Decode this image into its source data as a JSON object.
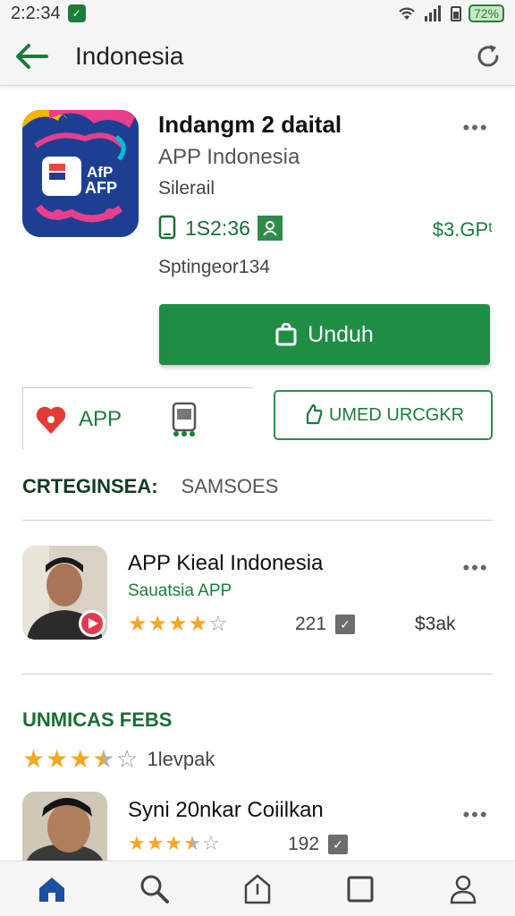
{
  "status_bar": {
    "time": "2:2:34",
    "battery": "72%"
  },
  "app_bar": {
    "title": "Indonesia"
  },
  "app": {
    "name": "Indangm 2 daital",
    "subtitle": "APP Indonesia",
    "category": "Silerail",
    "size": "1S2:36",
    "price": "$3.GPᵗ",
    "developer": "Sptingeor134",
    "icon_text_line1": "AfP",
    "icon_text_line2": "AFP",
    "install_label": "Unduh"
  },
  "actions": {
    "favorite_label": "APP",
    "wishlist_label": "UMED URCGKR"
  },
  "categories": {
    "heading": "CRTEGINSEA:",
    "value": "SAMSOES"
  },
  "list_items": [
    {
      "title": "APP Kieal Indonesia",
      "developer": "Sauatsia APP",
      "rating": 4,
      "count": "221",
      "price": "$3ak"
    },
    {
      "title": "Syni 20nkar Coiilkan",
      "rating": 3.5,
      "count": "192"
    }
  ],
  "reviews": {
    "heading": "UNMICAS FEBS",
    "rating": 3.5,
    "text": "1levpak"
  },
  "colors": {
    "accent": "#1e8e45",
    "star": "#f5a623",
    "icon_bg": "#1d3f93"
  },
  "bottom_nav": [
    "home-icon",
    "search-icon",
    "share-icon",
    "square-icon",
    "profile-icon"
  ]
}
